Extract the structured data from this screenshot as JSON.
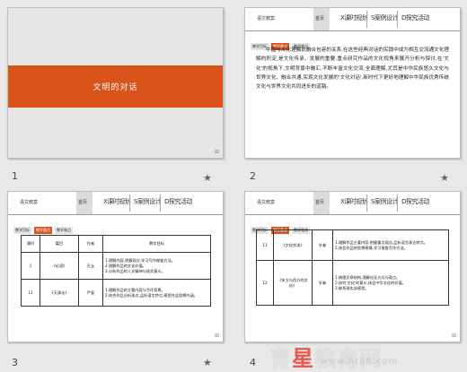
{
  "slides": [
    {
      "number": "1",
      "title": "文明的对话"
    },
    {
      "number": "2",
      "brand": "语文教案",
      "home": "首页",
      "nav": [
        "X课时规划",
        "S案例设计",
        "D探究活动"
      ],
      "tabs": [
        "教学目标",
        "教学重点",
        "教学难点"
      ],
      "paragraph": "中国与文化理解比融合包容的关系,在这些经典对话的实践中成为相互交流通文化理解的积淀,是文化传承、发展的重要,重点研究作品的文化视角来展开分析与探讨,在'文化'的视角下,文明背景中融汇,不断丰富文化交流,全面理解,尤其是中华民族悠久文化与世界文化、融合共通,实现文化发展的'文化对话',新时代下更好地理解中华民族优秀传统文化与世界文化共同进步的道路。"
    },
    {
      "number": "3",
      "brand": "语文教案",
      "home": "首页",
      "nav": [
        "X课时规划",
        "S案例设计",
        "D探究活动"
      ],
      "tabs": [
        "教学目标",
        "教学重点",
        "教学难点"
      ],
      "table": {
        "headers": [
          "课时",
          "篇目",
          "作者",
          "教学目标"
        ],
        "rows": [
          [
            "1",
            "《论语》",
            "孔丘",
            "1.理解内容,把握观点,学习写作借鉴方法。\n2.理解作品的文化价值。\n3.分析作品的人文精神与现实意义。"
          ],
          [
            "11",
            "《天演论》",
            "严复",
            "1.理解作品的主要内容与写作背景。\n2.结合作品分析观点,品析语言特点,感受作品思想内涵。"
          ]
        ]
      }
    },
    {
      "number": "4",
      "brand": "语文教案",
      "home": "首页",
      "nav": [
        "X课时规划",
        "S案例设计",
        "D探究活动"
      ],
      "tabs": [
        "教学目标",
        "教学重点",
        "教学难点"
      ],
      "table": {
        "rows": [
          [
            "11",
            "《文化交流》",
            "学者",
            "1.理解作品主要内容,把握重点观点,品析语言表达特点。\n2.体会作品的思想感情,学习借鉴写作方法。"
          ],
          [
            "12",
            "《东方与西方的文化》",
            "学者",
            "1.梳理文章结构,理解论证方式与观点。\n2.探究'文化'的意义,体会中华文化的价值。\n3.联系现实谈感受。"
          ]
        ]
      }
    }
  ],
  "watermark": {
    "text_1": "育",
    "text_red": "星",
    "text_2": "教育网",
    "url": "www.ht88.com"
  }
}
